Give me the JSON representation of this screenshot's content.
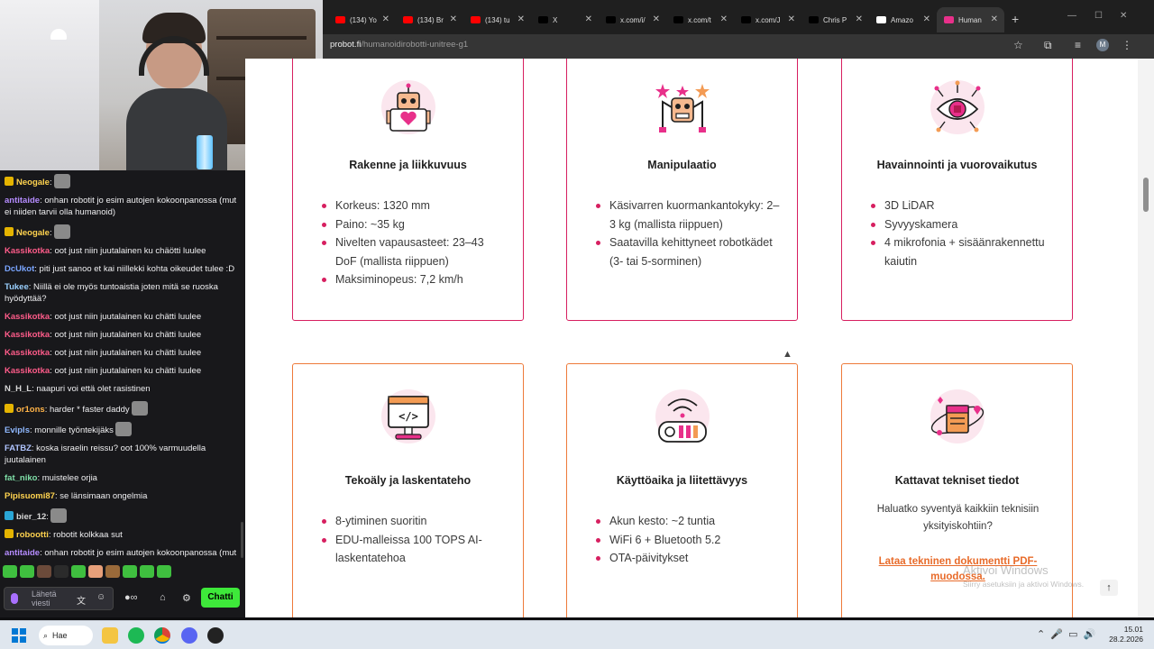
{
  "chat": {
    "messages": [
      {
        "user": "Neogale",
        "color": "#ffd34f",
        "text": "",
        "emotes": 1,
        "badge": "#e5b400"
      },
      {
        "user": "antitaide",
        "color": "#b58cff",
        "text": ": onhan robotit jo esim autojen kokoonpanossa (mut ei niiden tarvii olla humanoid)"
      },
      {
        "user": "Neogale",
        "color": "#ffd34f",
        "text": "",
        "emotes": 1,
        "badge": "#e5b400"
      },
      {
        "user": "Kassikotka",
        "color": "#ff5c8a",
        "text": ": oot just niin juutalainen ku chäötti luulee"
      },
      {
        "user": "DcUkot",
        "color": "#7aa5ff",
        "text": ": piti just sanoo et kai niillekki kohta oikeudet tulee :D"
      },
      {
        "user": "Tukee",
        "color": "#9ad0ff",
        "text": ": Niillä ei ole myös tuntoaistia joten mitä se ruoska hyödyttää?"
      },
      {
        "user": "Kassikotka",
        "color": "#ff5c8a",
        "text": ": oot just niin juutalainen ku chätti luulee"
      },
      {
        "user": "Kassikotka",
        "color": "#ff5c8a",
        "text": ": oot just niin juutalainen ku chätti luulee"
      },
      {
        "user": "Kassikotka",
        "color": "#ff5c8a",
        "text": ": oot just niin juutalainen ku chätti luulee"
      },
      {
        "user": "Kassikotka",
        "color": "#ff5c8a",
        "text": ": oot just niin juutalainen ku chätti luulee"
      },
      {
        "user": "N_H_L",
        "color": "#d8d8d8",
        "text": ": naapuri voi että olet rasistinen"
      },
      {
        "user": "or1ons",
        "color": "#ffb347",
        "text": ": harder * faster daddy",
        "emotes": 1,
        "badge": "#e5b400"
      },
      {
        "user": "Evipls",
        "color": "#8fb8ff",
        "text": ": monnille työntekijäks",
        "emotes": 1
      },
      {
        "user": "FATBZ",
        "color": "#b0c4ff",
        "text": ": koska israelin reissu? oot 100% varmuudella juutalainen"
      },
      {
        "user": "fat_niko",
        "color": "#7fe0a8",
        "text": ": muistelee  orjia",
        "emotes": 0
      },
      {
        "user": "Pipisuomi87",
        "color": "#ffd34f",
        "text": ": se länsimaan ongelmia"
      },
      {
        "user": "bier_12",
        "color": "#d8d8d8",
        "text": ":",
        "emotes": 1,
        "badge": "#2aa6d6"
      },
      {
        "user": "robootti",
        "color": "#ffd34f",
        "text": ": robotit kolkkaa sut",
        "badge": "#e5b400"
      },
      {
        "user": "antitaide",
        "color": "#b58cff",
        "text": ": onhan robotit jo esim autojen kokoonpanossa (mut ei niiden tarvii olla humanoid)"
      }
    ],
    "input_placeholder": "Lähetä viesti",
    "send_label": "Chatti"
  },
  "browser": {
    "tabs": [
      {
        "label": "(134) Yo",
        "favicon_color": "#ff0000"
      },
      {
        "label": "(134) Br",
        "favicon_color": "#ff0000"
      },
      {
        "label": "(134) tu",
        "favicon_color": "#ff0000"
      },
      {
        "label": "X",
        "favicon_color": "#000000"
      },
      {
        "label": "x.com/i/",
        "favicon_color": "#000000"
      },
      {
        "label": "x.com/t",
        "favicon_color": "#000000"
      },
      {
        "label": "x.com/J",
        "favicon_color": "#000000"
      },
      {
        "label": "Chris P",
        "favicon_color": "#000000"
      },
      {
        "label": "Amazo",
        "favicon_color": "#ffffff"
      },
      {
        "label": "Human",
        "favicon_color": "#e8308a"
      }
    ],
    "url_host": "probot.fi",
    "url_path": "/humanoidirobotti-unitree-g1",
    "profile_initial": "M"
  },
  "cards": [
    {
      "title": "Rakenne ja liikkuvuus",
      "items": [
        "Korkeus: 1320 mm",
        "Paino: ~35 kg",
        "Nivelten vapausasteet: 23–43 DoF (mallista riippuen)",
        "Maksiminopeus: 7,2 km/h"
      ],
      "icon": "robot-heart-icon"
    },
    {
      "title": "Manipulaatio",
      "items": [
        "Käsivarren kuormankantokyky: 2–3 kg (mallista riippuen)",
        "Saatavilla kehittyneet robotkädet (3- tai 5-sorminen)"
      ],
      "icon": "robot-arms-icon"
    },
    {
      "title": "Havainnointi ja vuorovaikutus",
      "items": [
        "3D LiDAR",
        "Syvyyskamera",
        "4 mikrofonia + sisäänrakennettu kaiutin"
      ],
      "icon": "eye-network-icon"
    },
    {
      "title": "Tekoäly ja laskentateho",
      "items": [
        "8-ytiminen suoritin",
        "EDU-malleissa 100 TOPS AI-laskentatehoa"
      ],
      "icon": "code-monitor-icon"
    },
    {
      "title": "Käyttöaika ja liitettävyys",
      "items": [
        "Akun kesto: ~2 tuntia",
        "WiFi 6 + Bluetooth 5.2",
        "OTA-päivitykset"
      ],
      "icon": "battery-wireless-icon"
    },
    {
      "title": "Kattavat tekniset tiedot",
      "description": "Haluatko syventyä kaikkiin teknisiin yksityiskohtiin?",
      "link": "Lataa tekninen dokumentti PDF-muodossa.",
      "icon": "document-orbit-icon"
    }
  ],
  "windows_activation": {
    "title": "Aktivoi Windows",
    "subtitle": "Siirry asetuksiin ja aktivoi Windows."
  },
  "taskbar": {
    "search_label": "Hae",
    "time": "15.01",
    "date": "28.2.2026"
  },
  "colors": {
    "accent": "#d71f60",
    "accent_orange": "#ee7a3a",
    "chat_send": "#3ee83a"
  }
}
